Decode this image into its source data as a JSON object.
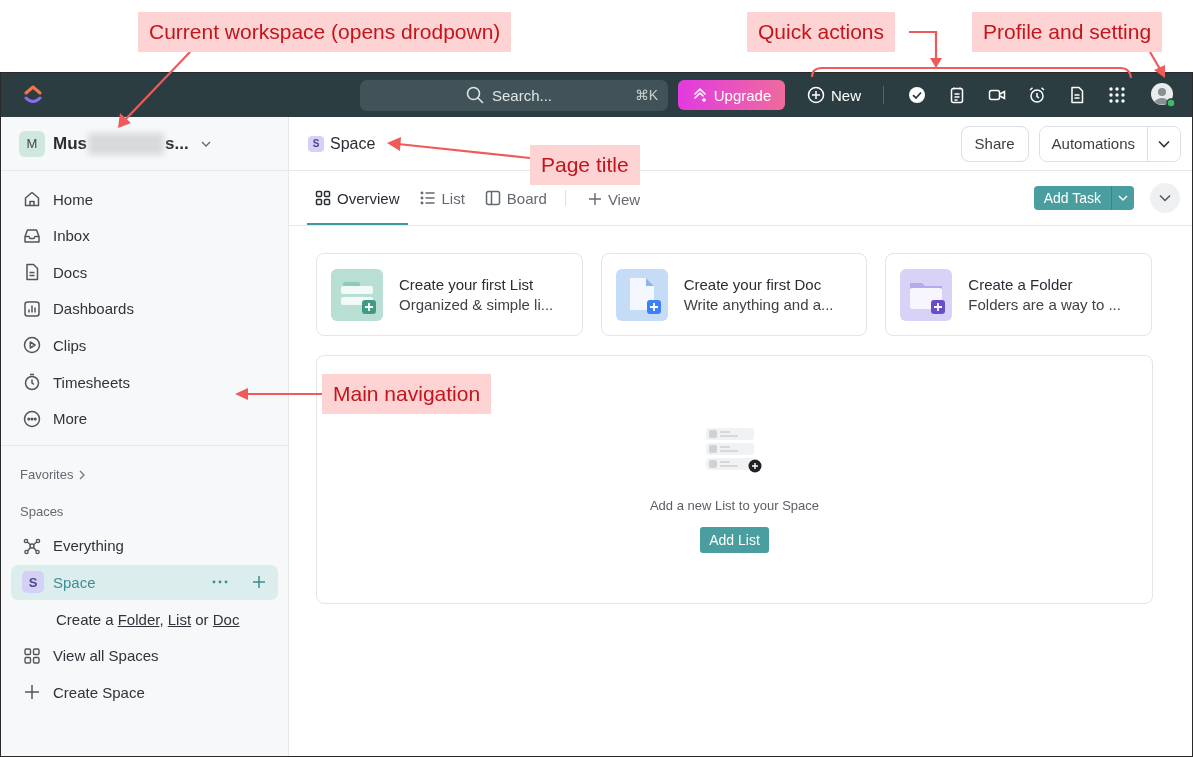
{
  "annotations": [
    {
      "text": "Current workspace (opens drodpown)"
    },
    {
      "text": "Quick actions"
    },
    {
      "text": "Profile and setting"
    },
    {
      "text": "Page title"
    },
    {
      "text": "Main navigation"
    }
  ],
  "topbar": {
    "search": {
      "placeholder": "Search...",
      "shortcut": "⌘K"
    },
    "upgrade": "Upgrade",
    "new": "New"
  },
  "sidebar": {
    "workspace": {
      "initial": "M",
      "name_start": "Mus",
      "name_end": "s..."
    },
    "nav": [
      {
        "label": "Home",
        "selected": false
      },
      {
        "label": "Inbox",
        "selected": false
      },
      {
        "label": "Docs",
        "selected": false
      },
      {
        "label": "Dashboards",
        "selected": false
      },
      {
        "label": "Clips",
        "selected": false
      },
      {
        "label": "Timesheets",
        "selected": false
      },
      {
        "label": "More",
        "selected": false
      }
    ],
    "favorites": "Favorites",
    "spaces_heading": "Spaces",
    "spaces": [
      {
        "label": "Everything",
        "selected": false
      },
      {
        "label": "Space",
        "badge": "S",
        "selected": true
      }
    ],
    "create_hint": [
      {
        "kind": "text",
        "text": "Create a "
      },
      {
        "kind": "link",
        "text": "Folder"
      },
      {
        "kind": "text",
        "text": ", "
      },
      {
        "kind": "link",
        "text": "List"
      },
      {
        "kind": "text",
        "text": " or "
      },
      {
        "kind": "link",
        "text": "Doc"
      }
    ],
    "footer": [
      {
        "label": "View all Spaces"
      },
      {
        "label": "Create Space"
      }
    ]
  },
  "main": {
    "header": {
      "badge": "S",
      "title": "Space",
      "share": "Share",
      "automations": "Automations"
    },
    "tabs": [
      {
        "label": "Overview",
        "selected": true
      },
      {
        "label": "List",
        "selected": false
      },
      {
        "label": "Board",
        "selected": false
      }
    ],
    "add_view": "View",
    "add_task": "Add Task",
    "cards": [
      {
        "kind": "list",
        "title": "Create your first List",
        "subtitle": "Organized & simple li..."
      },
      {
        "kind": "doc",
        "title": "Create your first Doc",
        "subtitle": "Write anything and a..."
      },
      {
        "kind": "folder",
        "title": "Create a Folder",
        "subtitle": "Folders are a way to ..."
      }
    ],
    "empty": {
      "message": "Add a new List to your Space",
      "button": "Add List"
    }
  }
}
